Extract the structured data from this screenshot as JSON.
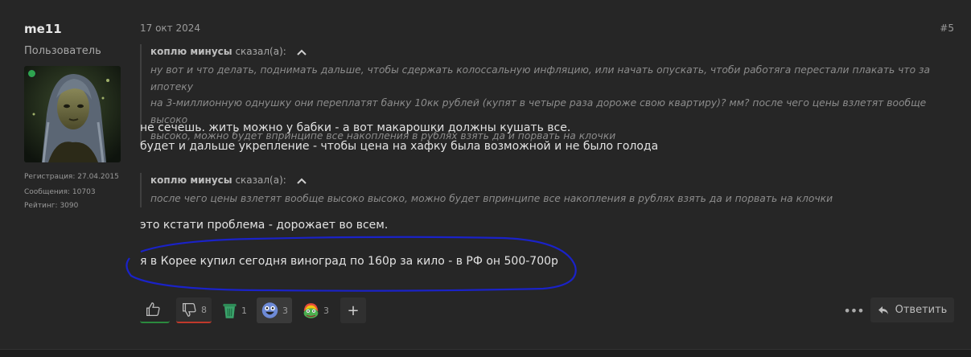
{
  "user": {
    "name": "me11",
    "title": "Пользователь",
    "stats": [
      {
        "label": "Регистрация:",
        "value": "27.04.2015"
      },
      {
        "label": "Сообщения:",
        "value": "10703"
      },
      {
        "label": "Рейтинг:",
        "value": "3090"
      }
    ],
    "online": true
  },
  "post": {
    "date": "17 окт 2024",
    "number": "#5",
    "quotes": [
      {
        "author": "коплю минусы",
        "said": "сказал(а):",
        "lines": [
          "ну вот и что делать, поднимать дальше, чтобы сдержать колоссальную инфляцию, или начать опускать, чтоби работяга перестали плакать что за ипотеку",
          "на 3-миллионную однушку они переплатят банку 10кк рублей (купят в четыре раза дороже свою квартиру)? мм? после чего цены взлетят вообще высоко",
          "высоко, можно будет впринципе все накопления в рублях взять да и порвать на клочки"
        ]
      },
      {
        "author": "коплю минусы",
        "said": "сказал(а):",
        "lines": [
          "после чего цены взлетят вообще высоко высоко, можно будет впринципе все накопления в рублях взять да и порвать на клочки"
        ]
      }
    ],
    "reply1": [
      "не сечешь. жить можно у бабки - а вот макарошки должны кушать все.",
      "будет и дальше укрепление - чтобы цена на хафку была возможной и не было голода"
    ],
    "reply2": "это кстати проблема - дорожает во всем.",
    "reply3": "я в Корее купил сегодня виноград по 160р за кило - в РФ он 500-700р"
  },
  "reactions": [
    {
      "name": "like",
      "icon": "thumbs-up-icon",
      "count": ""
    },
    {
      "name": "dislike",
      "icon": "thumbs-down-icon",
      "count": "8"
    },
    {
      "name": "trash",
      "icon": "trash-can-icon",
      "count": "1"
    },
    {
      "name": "laugh",
      "icon": "laughing-face-icon",
      "count": "3"
    },
    {
      "name": "pepe",
      "icon": "rainbow-frog-icon",
      "count": "3"
    }
  ],
  "actions": {
    "add": "+",
    "more": "•••",
    "reply": "Ответить"
  },
  "colors": {
    "background": "#262626",
    "like_accent": "#2b8a3e",
    "dislike_accent": "#c0392b",
    "annotation": "#1a22c8"
  }
}
